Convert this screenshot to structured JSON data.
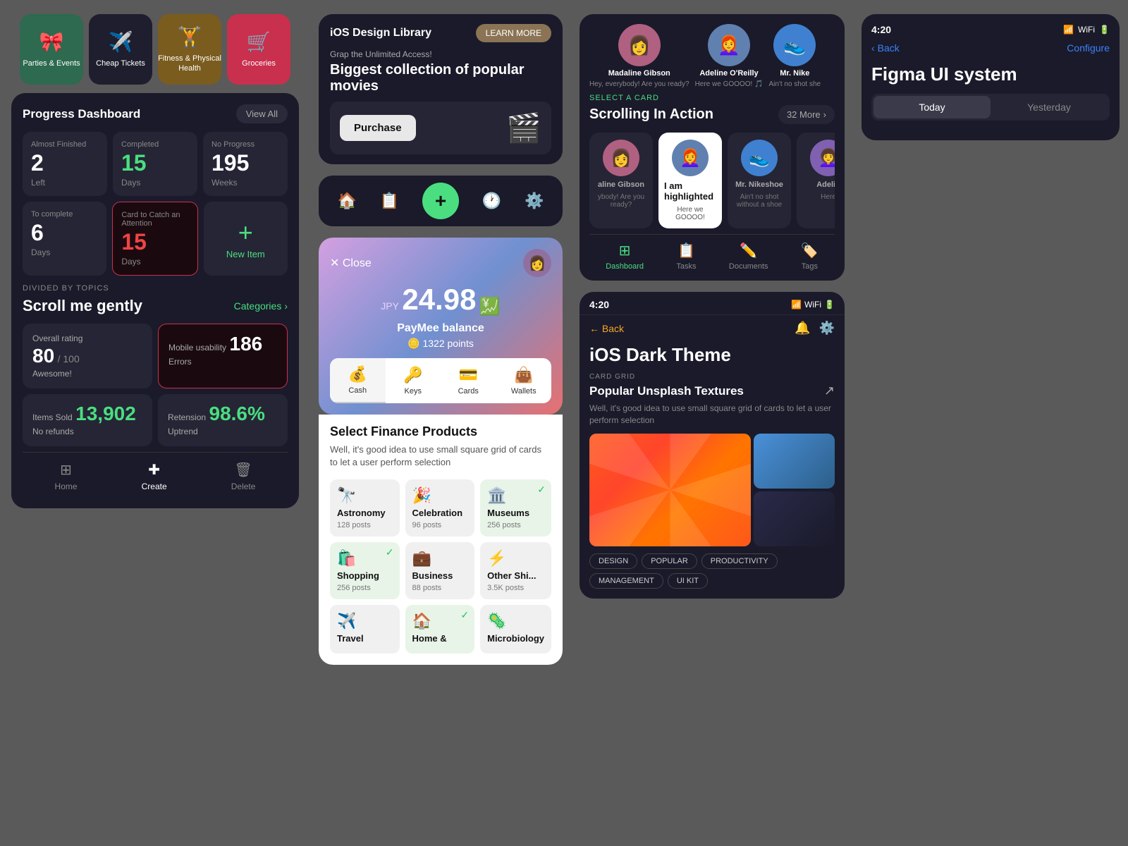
{
  "panel_progress": {
    "categories": [
      {
        "id": "parties",
        "icon": "🎀",
        "label": "Parties & Events",
        "color": "green"
      },
      {
        "id": "tickets",
        "icon": "✈️",
        "label": "Cheap Tickets",
        "color": "dark"
      },
      {
        "id": "fitness",
        "icon": "🏋️",
        "label": "Fitness & Physical Health",
        "color": "amber"
      },
      {
        "id": "groceries",
        "icon": "🛒",
        "label": "Groceries",
        "color": "pink"
      }
    ],
    "dashboard": {
      "title": "Progress Dashboard",
      "view_all": "View All",
      "stats_row1": [
        {
          "label": "Almost Finished",
          "number": "2",
          "number_color": "white",
          "sublabel": "Left"
        },
        {
          "label": "Completed",
          "number": "15",
          "number_color": "green",
          "sublabel": "Days"
        },
        {
          "label": "No Progress",
          "number": "195",
          "number_color": "white",
          "sublabel": "Weeks"
        }
      ],
      "stats_row2": [
        {
          "label": "To complete",
          "number": "6",
          "number_color": "white",
          "sublabel": "Days",
          "style": "normal"
        },
        {
          "label": "Card to Catch an Attention",
          "number": "15",
          "number_color": "red",
          "sublabel": "Days",
          "style": "red-border"
        },
        {
          "label": "",
          "number": "+",
          "number_color": "green",
          "sublabel": "New Item",
          "style": "new-item"
        }
      ]
    },
    "scroll_section": {
      "divided_label": "DIVIDED BY TOPICS",
      "title": "Scroll me gently",
      "categories_btn": "Categories"
    },
    "metrics": [
      {
        "label": "Overall rating",
        "number": "80",
        "suffix": "/ 100",
        "sublabel": "Awesome!",
        "color": "white",
        "style": "normal"
      },
      {
        "label": "Mobile usability",
        "number": "186",
        "sublabel": "Errors",
        "color": "white",
        "style": "red-border"
      },
      {
        "label": "Items Sold",
        "number": "13,902",
        "sublabel": "No refunds",
        "color": "green",
        "style": "normal"
      },
      {
        "label": "Retension",
        "number": "98.6%",
        "sublabel": "Uptrend",
        "color": "green",
        "style": "normal"
      }
    ],
    "nav": [
      {
        "icon": "⊞",
        "label": "Home",
        "active": false
      },
      {
        "icon": "✚",
        "label": "Create",
        "active": true
      },
      {
        "icon": "🗑",
        "label": "Delete",
        "active": false
      }
    ]
  },
  "panel_center": {
    "ios_library": {
      "title": "iOS Design Library",
      "learn_more": "LEARN MORE",
      "subtitle": "Grap the Unlimited Access!",
      "bigtext": "Biggest collection of popular movies",
      "purchase_btn": "Purchase"
    },
    "ios_nav": [
      {
        "icon": "🏠",
        "label": ""
      },
      {
        "icon": "📋",
        "label": ""
      },
      {
        "icon": "+",
        "label": "",
        "fab": true
      },
      {
        "icon": "🕐",
        "label": ""
      },
      {
        "icon": "⚙️",
        "label": ""
      }
    ],
    "finance": {
      "currency_label": "JPY",
      "amount": "24.98",
      "emoji": "💹",
      "balance_label": "PayMee balance",
      "points": "🪙 1322 points",
      "close_label": "✕ Close",
      "tabs": [
        {
          "icon": "💰",
          "label": "Cash",
          "active": true
        },
        {
          "icon": "🔑",
          "label": "Keys",
          "active": false
        },
        {
          "icon": "💳",
          "label": "Cards",
          "active": false
        },
        {
          "icon": "👜",
          "label": "Wallets",
          "active": false
        }
      ]
    },
    "select_finance": {
      "title": "Select Finance Products",
      "desc": "Well, it's good idea to use small square grid of cards to let a user perform selection",
      "items": [
        {
          "icon": "🔭",
          "name": "Astronomy",
          "posts": "128 posts",
          "selected": false
        },
        {
          "icon": "🎉",
          "name": "Celebration",
          "posts": "96 posts",
          "selected": false
        },
        {
          "icon": "🏛️",
          "name": "Museums",
          "posts": "256 posts",
          "selected": true
        },
        {
          "icon": "🛍️",
          "name": "Shopping",
          "posts": "256 posts",
          "selected": true
        },
        {
          "icon": "💼",
          "name": "Business",
          "posts": "88 posts",
          "selected": false
        },
        {
          "icon": "⚡",
          "name": "Other Shi...",
          "posts": "3.5K posts",
          "selected": false
        },
        {
          "icon": "✈️",
          "name": "Travel",
          "posts": "",
          "selected": false
        },
        {
          "icon": "🏠",
          "name": "Home &",
          "posts": "",
          "selected": true
        },
        {
          "icon": "🦠",
          "name": "Microbiology",
          "posts": "",
          "selected": false
        }
      ]
    }
  },
  "panel_right": {
    "scrolling": {
      "select_card_label": "SELECT A CARD",
      "title": "Scrolling In Action",
      "more_btn": "32 More",
      "top_avatars": [
        {
          "emoji": "👩",
          "name": "Madaline Gibson",
          "status": "Hey, everybody! Are you ready?"
        },
        {
          "emoji": "👩‍🦰",
          "name": "Adeline O'Reilly",
          "status": "Here we GOOOO! 🎵"
        },
        {
          "emoji": "👟",
          "name": "Mr. Nike",
          "status": "Ain't no shot she"
        }
      ],
      "bottom_avatars": [
        {
          "emoji": "👩",
          "name": "aline Gibson",
          "status": "ybody! Are you ready?",
          "highlighted": false
        },
        {
          "emoji": "👩‍🦰",
          "name": "I am highlighted",
          "status": "Here we GOOOO!",
          "highlighted": true
        },
        {
          "emoji": "👟",
          "name": "Mr. Nikeshoe",
          "status": "Ain't no shot without a shoe",
          "highlighted": false
        },
        {
          "emoji": "👩‍🦱",
          "name": "Adelin",
          "status": "Here",
          "highlighted": false
        }
      ],
      "nav": [
        {
          "icon": "⊞",
          "label": "Dashboard",
          "active": true
        },
        {
          "icon": "📋",
          "label": "Tasks",
          "active": false
        },
        {
          "icon": "✏️",
          "label": "Documents",
          "active": false
        },
        {
          "icon": "🏷️",
          "label": "Tags",
          "active": false
        }
      ]
    },
    "dark_theme": {
      "time": "4:20",
      "signal": "📶",
      "wifi": "WiFi",
      "battery": "🔋",
      "back_label": "← Back",
      "bell_icon": "🔔",
      "settings_icon": "⚙️",
      "title": "iOS Dark Theme",
      "card_grid_label": "CARD GRID",
      "popular_title": "Popular Unsplash Textures",
      "popular_desc": "Well, it's good idea to use small square grid of cards to let a user perform selection",
      "tags": [
        "DESIGN",
        "POPULAR",
        "PRODUCTIVITY",
        "MANAGEMENT",
        "UI KIT"
      ]
    }
  },
  "panel_figma": {
    "time": "4:20",
    "back_label": "Back",
    "configure_label": "Configure",
    "title": "Figma UI system",
    "tabs": [
      {
        "label": "Today",
        "active": true
      },
      {
        "label": "Yesterday",
        "active": false
      }
    ]
  }
}
